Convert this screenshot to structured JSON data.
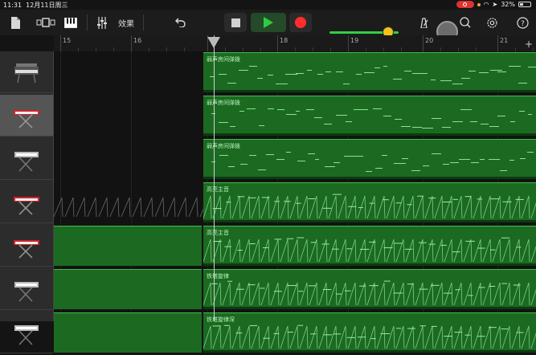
{
  "status": {
    "time": "11:31",
    "date": "12月11日周三",
    "battery": "32%"
  },
  "toolbar": {
    "effects_label": "效果"
  },
  "ruler": {
    "bars": [
      "15",
      "16",
      "17",
      "18",
      "19",
      "20",
      "21"
    ]
  },
  "tracks": [
    {
      "icon": "synth-keyboard-icon",
      "region": "弱声房间弹拨"
    },
    {
      "icon": "red-keyboard-icon",
      "region": "弱声房间弹拨"
    },
    {
      "icon": "keyboard-stand-icon",
      "region": "弱声房间弹拨"
    },
    {
      "icon": "red-keyboard-icon",
      "region": "高亮主音"
    },
    {
      "icon": "red-keyboard-icon",
      "region": "高亮主音"
    },
    {
      "icon": "keyboard-stand-icon",
      "region": "铁塔旋律"
    },
    {
      "icon": "keyboard-stand-icon",
      "region": "铁塔旋律深"
    }
  ],
  "colors": {
    "region": "#1c6a22",
    "accent_green": "#2ecc40",
    "record_red": "#ff2d2d",
    "volume_knob": "#f3c21a"
  }
}
